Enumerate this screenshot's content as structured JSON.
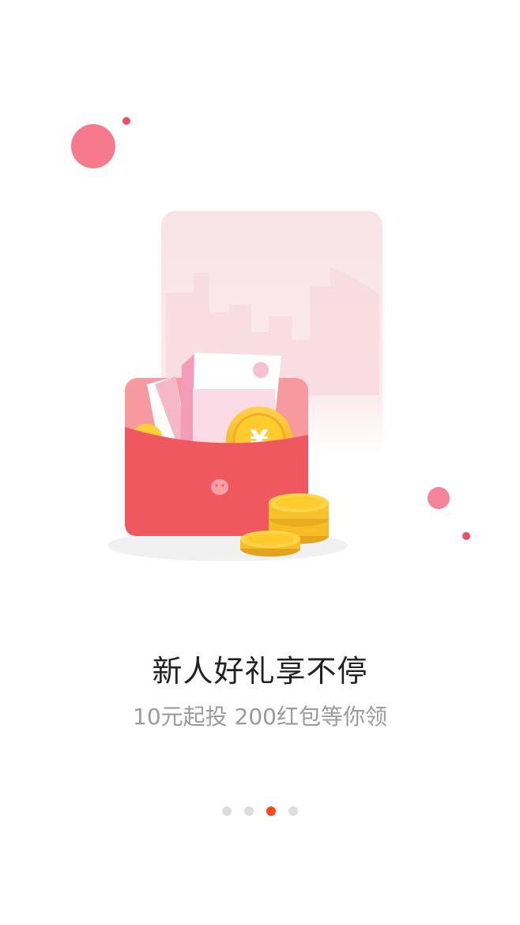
{
  "onboarding": {
    "title": "新人好礼享不停",
    "subtitle": "10元起投 200红包等你领",
    "page_indicator": {
      "count": 4,
      "active_index": 2
    }
  },
  "illustration": {
    "icons": [
      "decor-circle-icon",
      "red-envelope-icon",
      "gold-coin-icon",
      "city-skyline-icon"
    ],
    "currency_symbol": "¥"
  },
  "colors": {
    "accent": "#ff4a1c",
    "envelope": "#f0585f",
    "decor_pink": "#f77a8c",
    "title": "#222222",
    "subtitle": "#9a9a9a",
    "dot_inactive": "#dcdcdc"
  }
}
